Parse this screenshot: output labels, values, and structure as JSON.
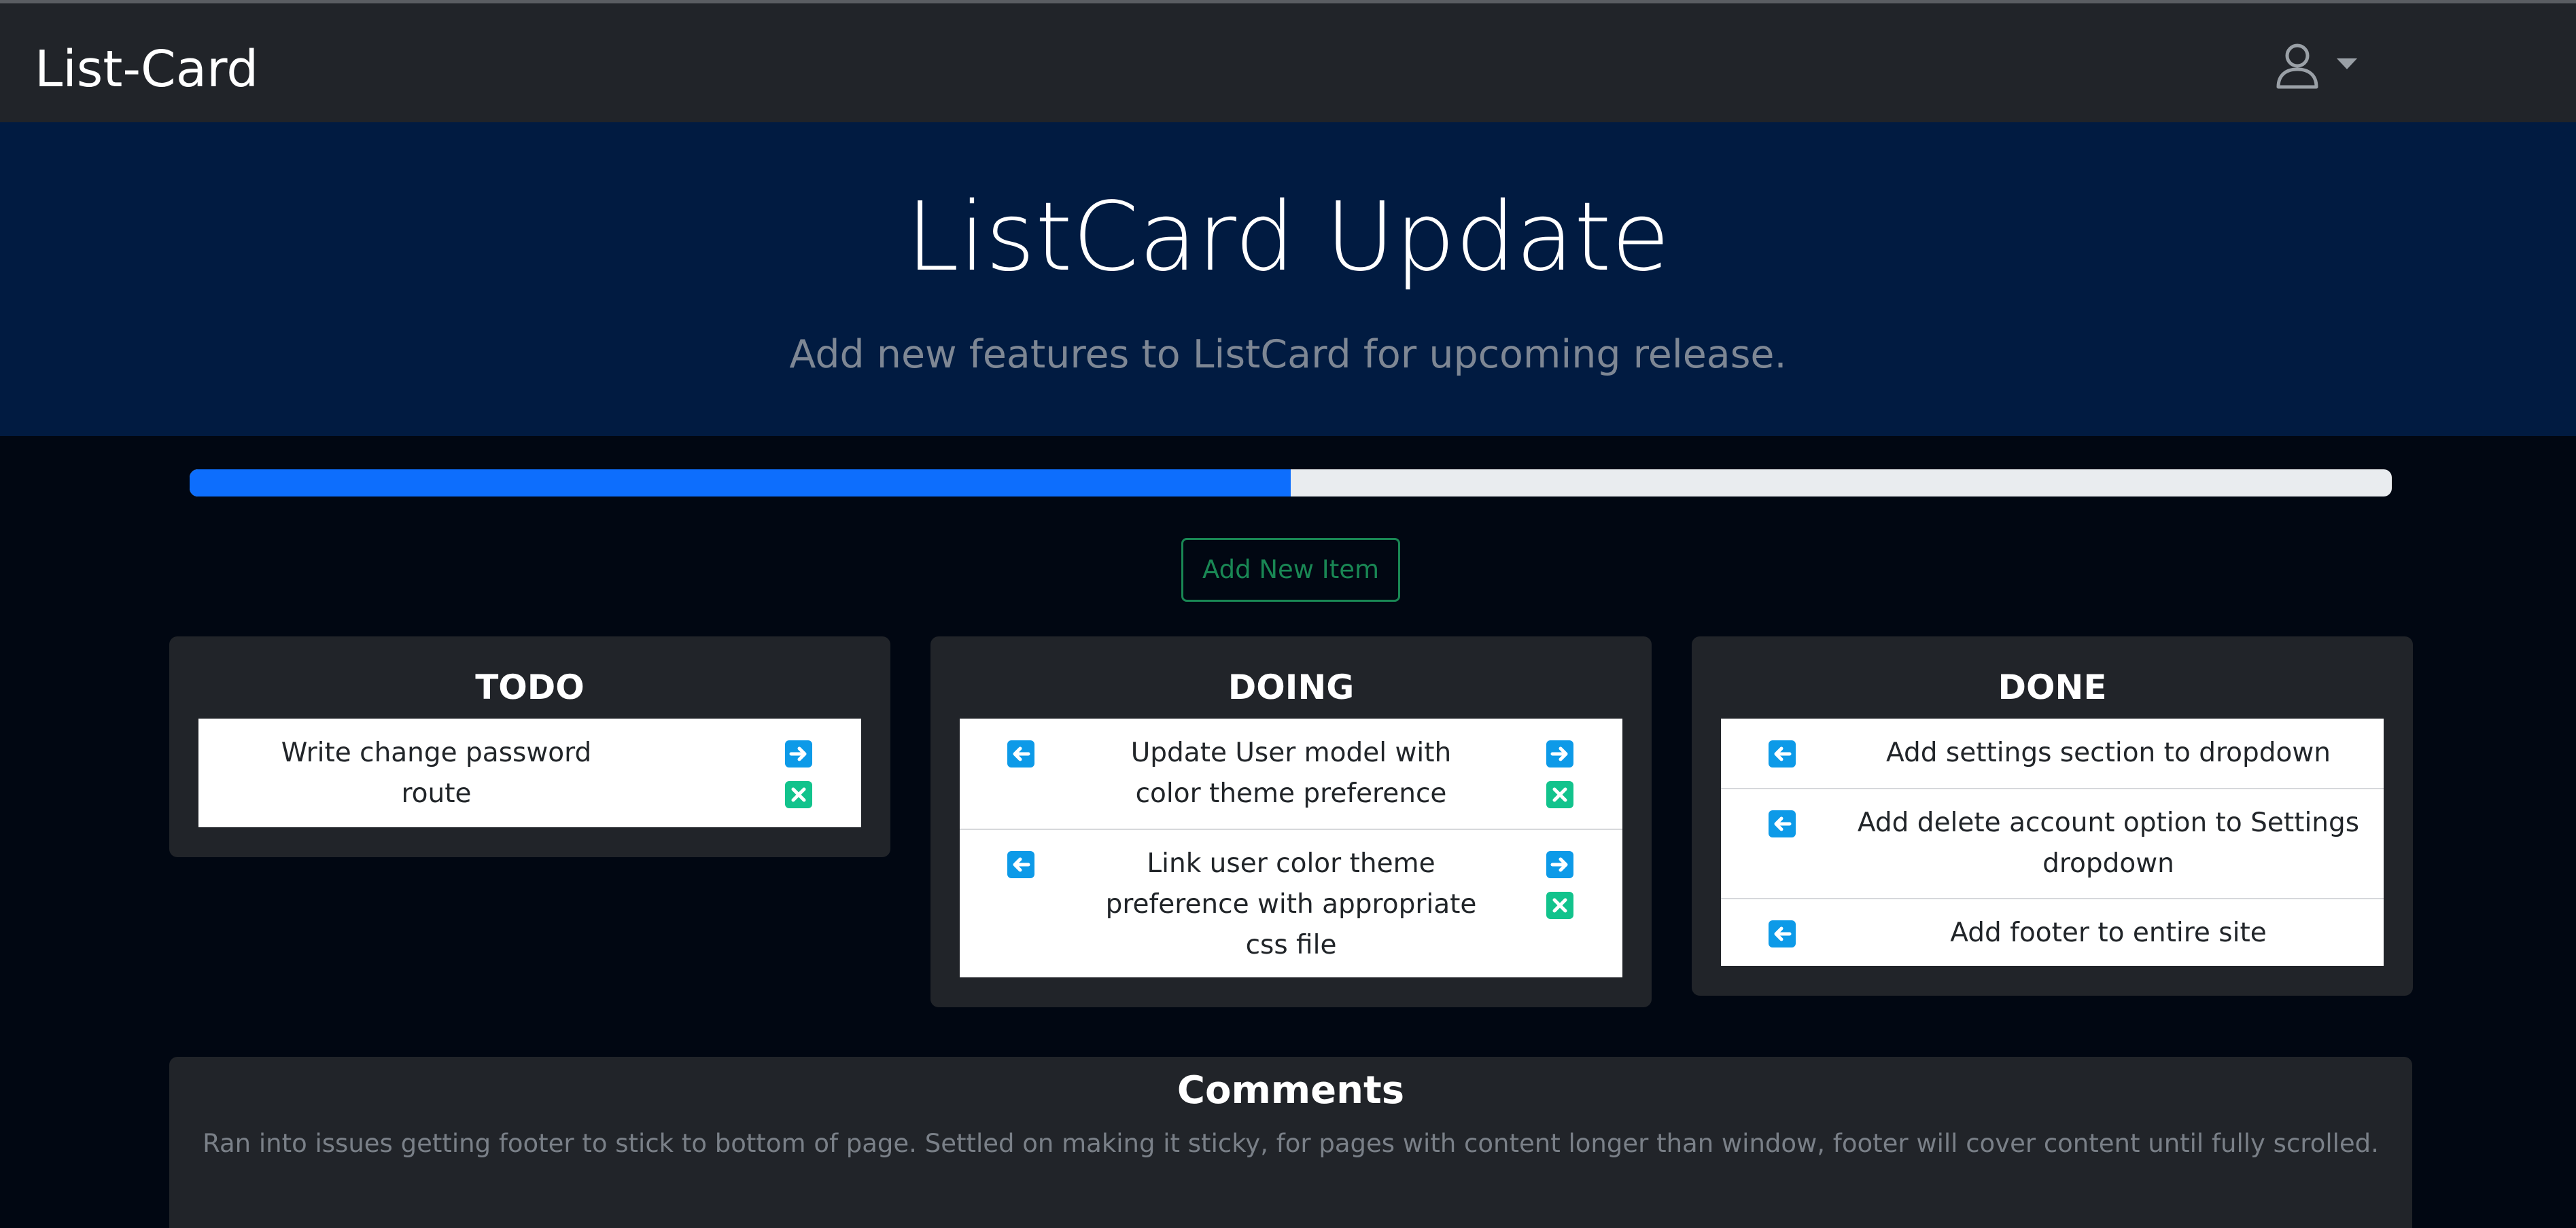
{
  "navbar": {
    "brand": "List-Card",
    "user_icon": "person-icon",
    "caret_icon": "caret-down-icon"
  },
  "hero": {
    "title": "ListCard Update",
    "subtitle": "Add new features to ListCard for upcoming release."
  },
  "progress": {
    "percent": 50,
    "fill_color": "#0d6efd",
    "track_color": "#e9ecef"
  },
  "actions": {
    "add_item_label": "Add New Item"
  },
  "columns": [
    {
      "title": "TODO",
      "items": [
        {
          "text": "Write change password route",
          "left_icon": null,
          "right_icon": "arrow-right-icon",
          "delete_icon": "close-x-icon"
        }
      ]
    },
    {
      "title": "DOING",
      "items": [
        {
          "text": "Update User model with color theme preference",
          "left_icon": "arrow-left-icon",
          "right_icon": "arrow-right-icon",
          "delete_icon": "close-x-icon"
        },
        {
          "text": "Link user color theme preference with appropriate css file",
          "left_icon": "arrow-left-icon",
          "right_icon": "arrow-right-icon",
          "delete_icon": "close-x-icon"
        }
      ]
    },
    {
      "title": "DONE",
      "items": [
        {
          "text": "Add settings section to dropdown",
          "left_icon": "arrow-left-icon"
        },
        {
          "text": "Add delete account option to Settings dropdown",
          "left_icon": "arrow-left-icon"
        },
        {
          "text": "Add footer to entire site",
          "left_icon": "arrow-left-icon"
        }
      ]
    }
  ],
  "comments": {
    "title": "Comments",
    "text": "Ran into issues getting footer to stick to bottom of page. Settled on making it sticky, for pages with content longer than window, footer will cover content until fully scrolled."
  },
  "colors": {
    "navbar": "#212429",
    "hero": "#011b41",
    "page_background": "#010712",
    "accent_blue": "#0d9ae8",
    "accent_green": "#12c38c",
    "button_green": "#198754"
  }
}
